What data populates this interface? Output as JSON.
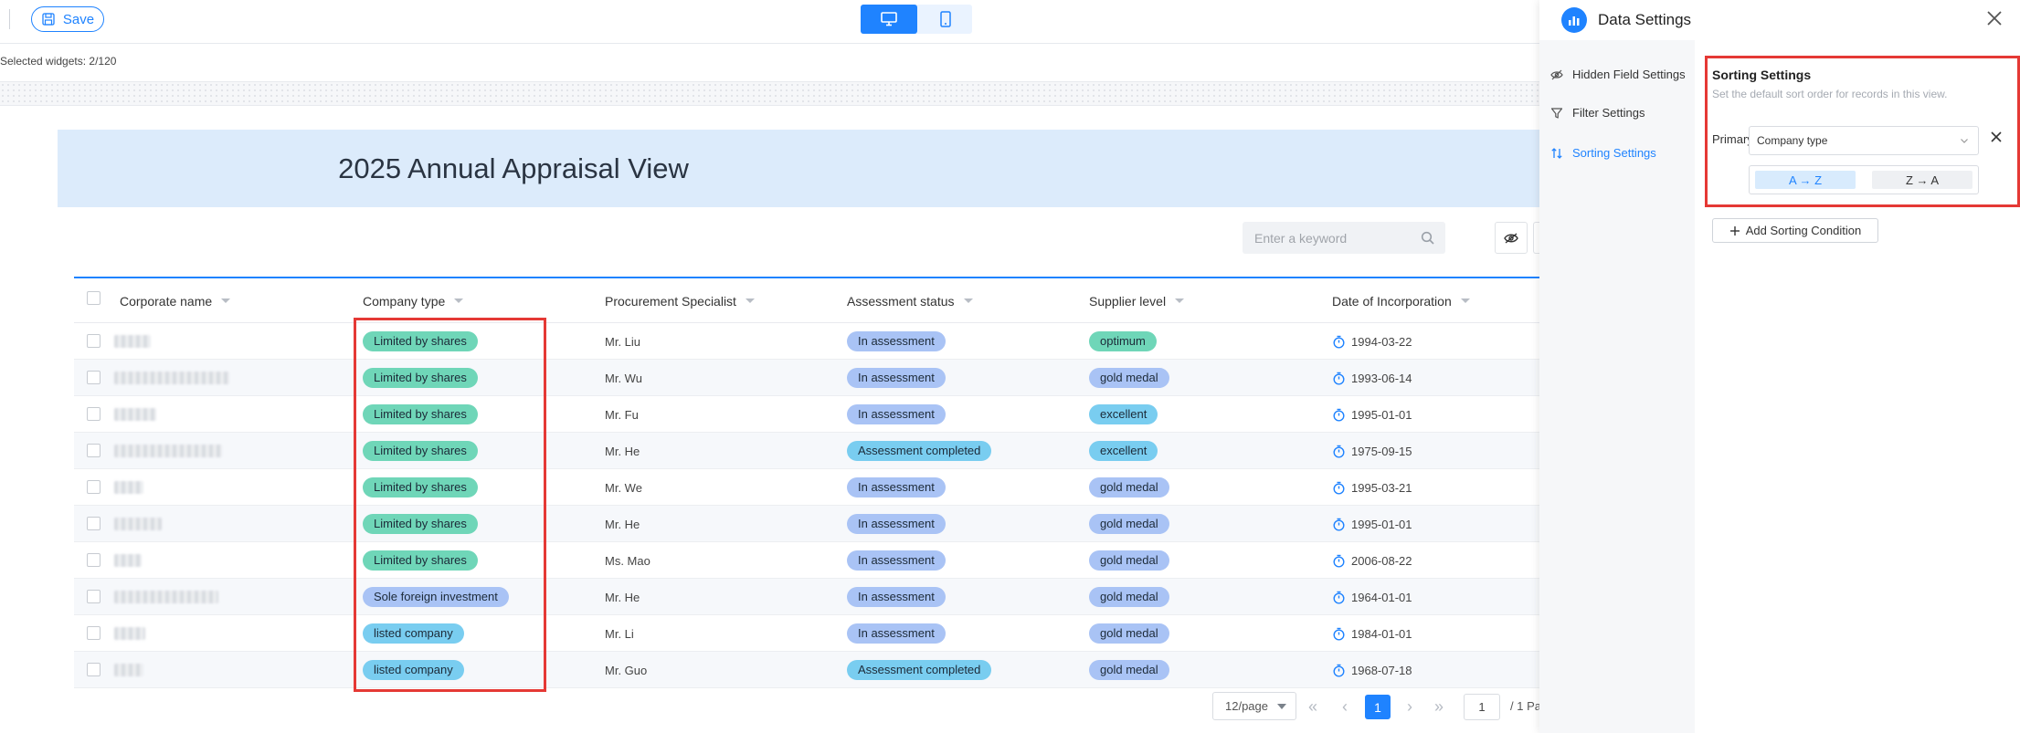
{
  "toolbar": {
    "save_label": "Save"
  },
  "canvas": {
    "selected_widgets": "Selected widgets: 2/120"
  },
  "view": {
    "title": "2025 Annual Appraisal View",
    "search_placeholder": "Enter a keyword"
  },
  "table": {
    "columns": [
      "Corporate name",
      "Company type",
      "Procurement Specialist",
      "Assessment status",
      "Supplier level",
      "Date of Incorporation"
    ],
    "rows": [
      {
        "company_type": "Limited by shares",
        "specialist": "Mr. Liu",
        "status": "In assessment",
        "level": "optimum",
        "date": "1994-03-22"
      },
      {
        "company_type": "Limited by shares",
        "specialist": "Mr. Wu",
        "status": "In assessment",
        "level": "gold medal",
        "date": "1993-06-14"
      },
      {
        "company_type": "Limited by shares",
        "specialist": "Mr. Fu",
        "status": "In assessment",
        "level": "excellent",
        "date": "1995-01-01"
      },
      {
        "company_type": "Limited by shares",
        "specialist": "Mr. He",
        "status": "Assessment completed",
        "level": "excellent",
        "date": "1975-09-15"
      },
      {
        "company_type": "Limited by shares",
        "specialist": "Mr. We",
        "status": "In assessment",
        "level": "gold medal",
        "date": "1995-03-21"
      },
      {
        "company_type": "Limited by shares",
        "specialist": "Mr. He",
        "status": "In assessment",
        "level": "gold medal",
        "date": "1995-01-01"
      },
      {
        "company_type": "Limited by shares",
        "specialist": "Ms. Mao",
        "status": "In assessment",
        "level": "gold medal",
        "date": "2006-08-22"
      },
      {
        "company_type": "Sole foreign investment",
        "specialist": "Mr. He",
        "status": "In assessment",
        "level": "gold medal",
        "date": "1964-01-01"
      },
      {
        "company_type": "listed company",
        "specialist": "Mr. Li",
        "status": "In assessment",
        "level": "gold medal",
        "date": "1984-01-01"
      },
      {
        "company_type": "listed company",
        "specialist": "Mr. Guo",
        "status": "Assessment completed",
        "level": "gold medal",
        "date": "1968-07-18"
      }
    ]
  },
  "pagination": {
    "page_size": "12/page",
    "current_page": "1",
    "page_input": "1",
    "total": "/ 1 Pa"
  },
  "panel": {
    "title": "Data Settings",
    "nav": [
      {
        "label": "Hidden Field Settings",
        "icon": "eye-off-icon"
      },
      {
        "label": "Filter Settings",
        "icon": "filter-icon"
      },
      {
        "label": "Sorting Settings",
        "icon": "sort-icon"
      }
    ],
    "sorting": {
      "title": "Sorting Settings",
      "description": "Set the default sort order for records in this view.",
      "primary_label": "Primary",
      "field_value": "Company type",
      "asc_label": "A → Z",
      "desc_label": "Z → A",
      "add_label": "Add Sorting Condition"
    }
  },
  "colors": {
    "accent": "#1f83ff",
    "tag_green": "#6fd6b8",
    "tag_blue": "#79cdf0",
    "tag_purple": "#a9c3f5",
    "highlight": "#e53935"
  }
}
